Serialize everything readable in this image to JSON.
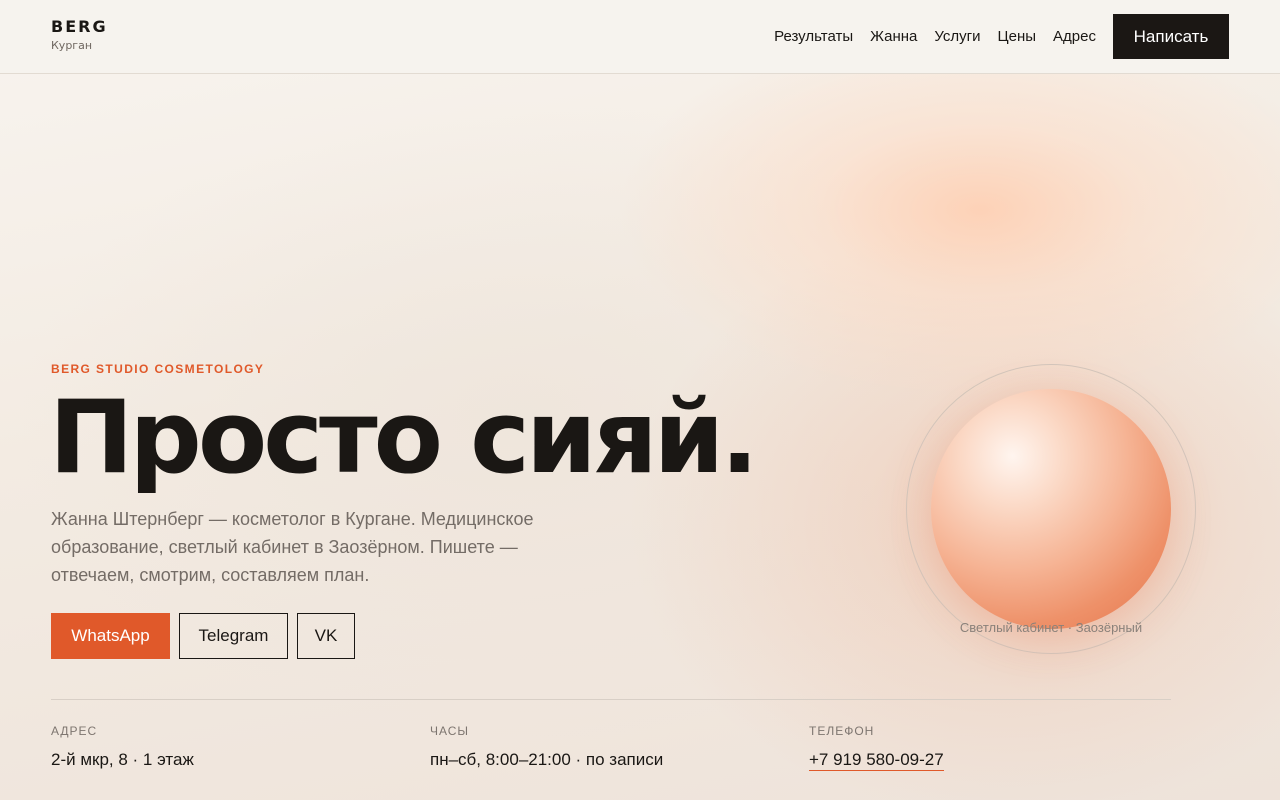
{
  "header": {
    "brand": "BERG",
    "city": "Курган",
    "nav": [
      "Результаты",
      "Жанна",
      "Услуги",
      "Цены",
      "Адрес"
    ],
    "cta": "Написать"
  },
  "hero": {
    "eyebrow": "BERG STUDIO COSMETOLOGY",
    "headline": "Просто сияй.",
    "lead": "Жанна Штернберг — косметолог в Кургане. Медицинское образование, светлый кабинет в Заозёрном. Пишете — отвечаем, смотрим, составляем план.",
    "buttons": {
      "whatsapp": "WhatsApp",
      "telegram": "Telegram",
      "vk": "VK"
    },
    "visual_caption": "Светлый кабинет · Заозёрный"
  },
  "info": {
    "address_label": "АДРЕС",
    "address_value": "2-й мкр, 8 · 1 этаж",
    "hours_label": "ЧАСЫ",
    "hours_value": "пн–сб, 8:00–21:00 · по записи",
    "phone_label": "ТЕЛЕФОН",
    "phone_value": "+7 919 580-09-27"
  },
  "colors": {
    "accent": "#e0592a",
    "dark": "#1b1714",
    "header_bg": "#f6f3ee"
  }
}
